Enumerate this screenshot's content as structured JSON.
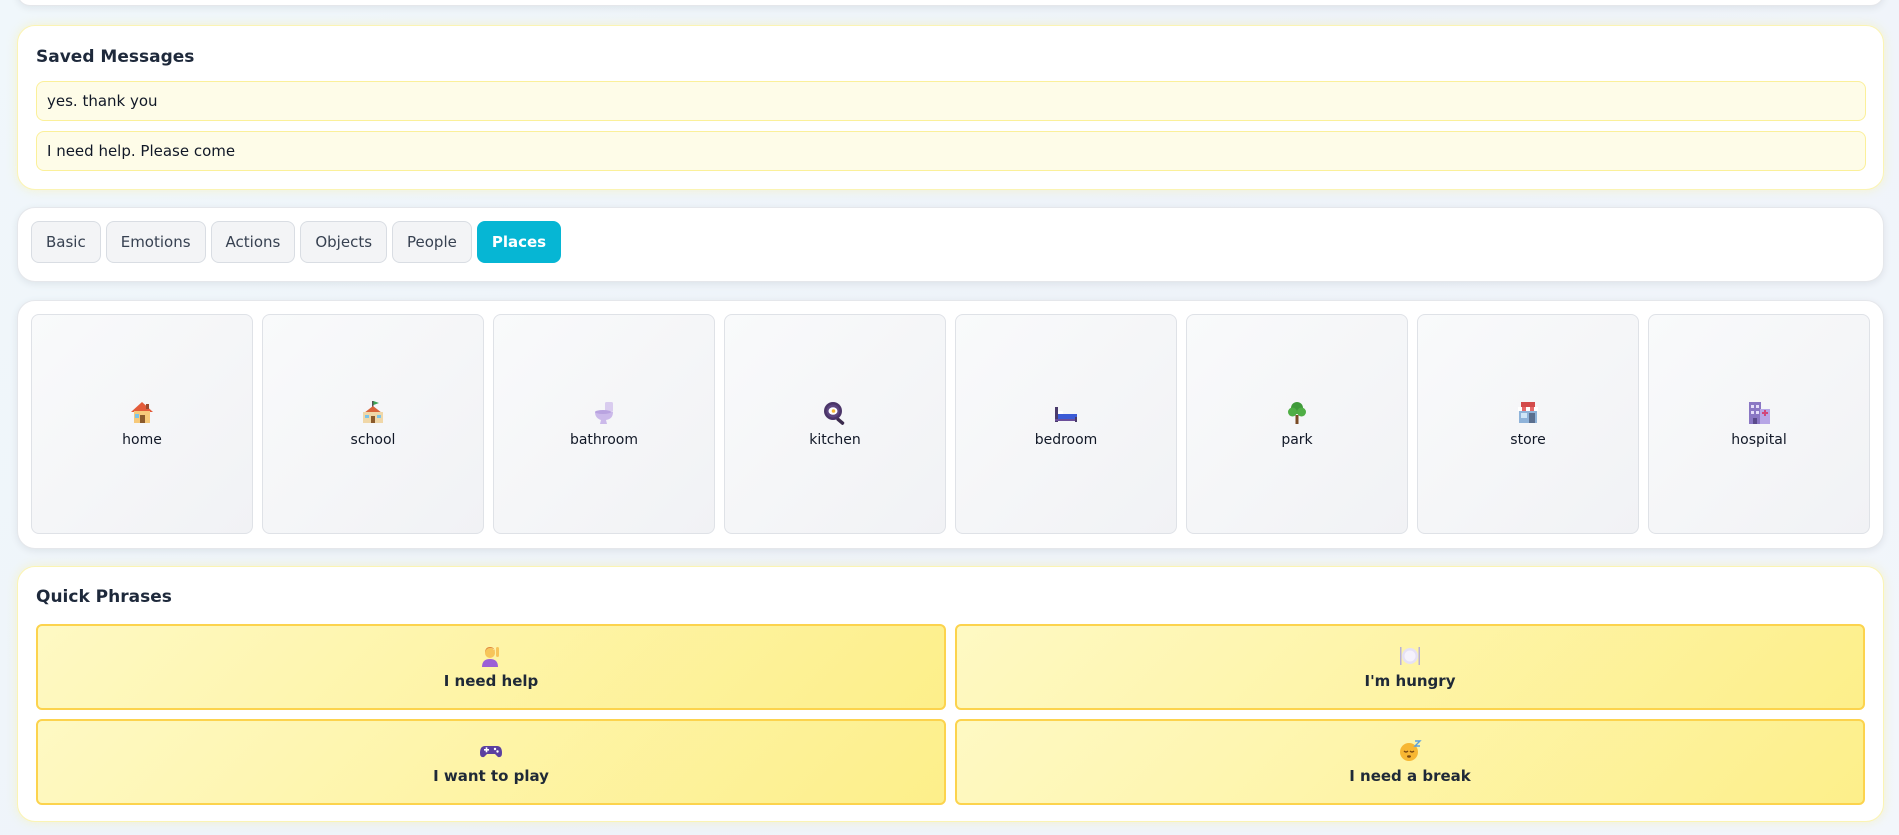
{
  "saved_messages": {
    "title": "Saved Messages",
    "items": [
      "yes. thank you",
      "I need help. Please come"
    ]
  },
  "tabs": [
    "Basic",
    "Emotions",
    "Actions",
    "Objects",
    "People",
    "Places"
  ],
  "active_tab": "Places",
  "places": [
    {
      "label": "home",
      "icon": "house-icon"
    },
    {
      "label": "school",
      "icon": "school-icon"
    },
    {
      "label": "bathroom",
      "icon": "toilet-icon"
    },
    {
      "label": "kitchen",
      "icon": "frying-pan-icon"
    },
    {
      "label": "bedroom",
      "icon": "bed-icon"
    },
    {
      "label": "park",
      "icon": "tree-icon"
    },
    {
      "label": "store",
      "icon": "store-icon"
    },
    {
      "label": "hospital",
      "icon": "hospital-icon"
    }
  ],
  "quick_phrases": {
    "title": "Quick Phrases",
    "items": [
      {
        "label": "I need help",
        "icon": "raised-hand-person-icon"
      },
      {
        "label": "I'm hungry",
        "icon": "plate-cutlery-icon"
      },
      {
        "label": "I want to play",
        "icon": "game-controller-icon"
      },
      {
        "label": "I need a break",
        "icon": "sleepy-face-icon"
      }
    ]
  },
  "colors": {
    "accent": "#06b6d4",
    "phrase_bg": "#fdef8a",
    "saved_bg": "#fefce8"
  }
}
